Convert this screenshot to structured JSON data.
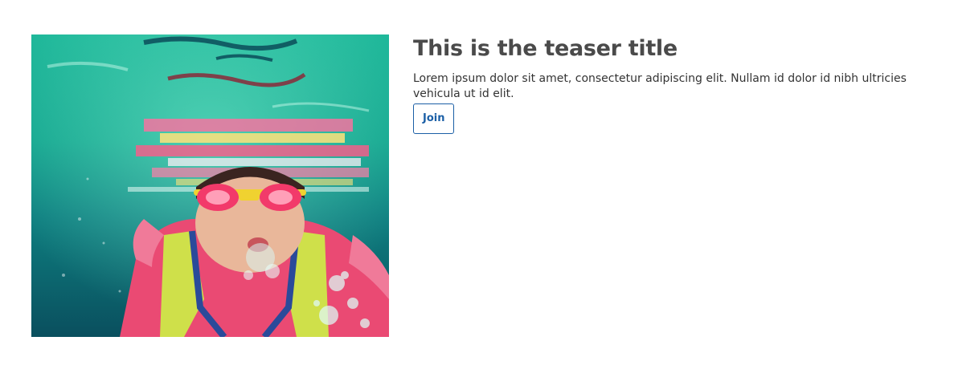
{
  "teaser": {
    "image_subject": "child-swimming-underwater-photo",
    "title": "This is the teaser title",
    "body": "Lorem ipsum dolor sit amet, consectetur adipiscing elit. Nullam id dolor id nibh ultricies vehicula ut id elit.",
    "button_label": "Join"
  },
  "colors": {
    "title_text": "#4a4a4a",
    "body_text": "#333333",
    "button_accent": "#1b5fa6",
    "background": "#ffffff"
  }
}
